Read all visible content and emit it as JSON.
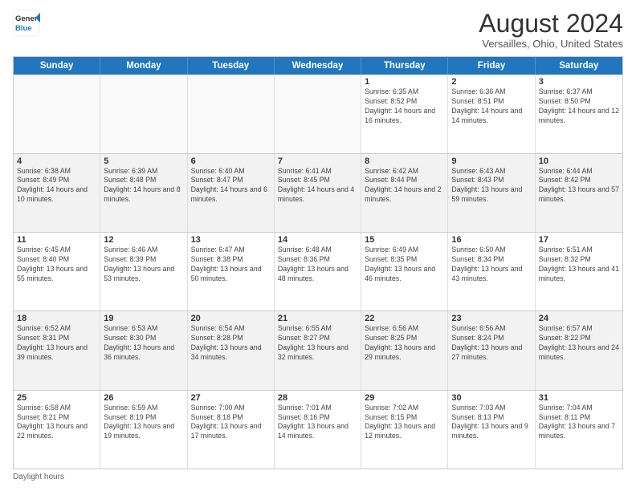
{
  "logo": {
    "general": "General",
    "blue": "Blue"
  },
  "title": "August 2024",
  "subtitle": "Versailles, Ohio, United States",
  "days": [
    "Sunday",
    "Monday",
    "Tuesday",
    "Wednesday",
    "Thursday",
    "Friday",
    "Saturday"
  ],
  "weeks": [
    [
      {
        "day": "",
        "text": ""
      },
      {
        "day": "",
        "text": ""
      },
      {
        "day": "",
        "text": ""
      },
      {
        "day": "",
        "text": ""
      },
      {
        "day": "1",
        "text": "Sunrise: 6:35 AM\nSunset: 8:52 PM\nDaylight: 14 hours and 16 minutes."
      },
      {
        "day": "2",
        "text": "Sunrise: 6:36 AM\nSunset: 8:51 PM\nDaylight: 14 hours and 14 minutes."
      },
      {
        "day": "3",
        "text": "Sunrise: 6:37 AM\nSunset: 8:50 PM\nDaylight: 14 hours and 12 minutes."
      }
    ],
    [
      {
        "day": "4",
        "text": "Sunrise: 6:38 AM\nSunset: 8:49 PM\nDaylight: 14 hours and 10 minutes."
      },
      {
        "day": "5",
        "text": "Sunrise: 6:39 AM\nSunset: 8:48 PM\nDaylight: 14 hours and 8 minutes."
      },
      {
        "day": "6",
        "text": "Sunrise: 6:40 AM\nSunset: 8:47 PM\nDaylight: 14 hours and 6 minutes."
      },
      {
        "day": "7",
        "text": "Sunrise: 6:41 AM\nSunset: 8:45 PM\nDaylight: 14 hours and 4 minutes."
      },
      {
        "day": "8",
        "text": "Sunrise: 6:42 AM\nSunset: 8:44 PM\nDaylight: 14 hours and 2 minutes."
      },
      {
        "day": "9",
        "text": "Sunrise: 6:43 AM\nSunset: 8:43 PM\nDaylight: 13 hours and 59 minutes."
      },
      {
        "day": "10",
        "text": "Sunrise: 6:44 AM\nSunset: 8:42 PM\nDaylight: 13 hours and 57 minutes."
      }
    ],
    [
      {
        "day": "11",
        "text": "Sunrise: 6:45 AM\nSunset: 8:40 PM\nDaylight: 13 hours and 55 minutes."
      },
      {
        "day": "12",
        "text": "Sunrise: 6:46 AM\nSunset: 8:39 PM\nDaylight: 13 hours and 53 minutes."
      },
      {
        "day": "13",
        "text": "Sunrise: 6:47 AM\nSunset: 8:38 PM\nDaylight: 13 hours and 50 minutes."
      },
      {
        "day": "14",
        "text": "Sunrise: 6:48 AM\nSunset: 8:36 PM\nDaylight: 13 hours and 48 minutes."
      },
      {
        "day": "15",
        "text": "Sunrise: 6:49 AM\nSunset: 8:35 PM\nDaylight: 13 hours and 46 minutes."
      },
      {
        "day": "16",
        "text": "Sunrise: 6:50 AM\nSunset: 8:34 PM\nDaylight: 13 hours and 43 minutes."
      },
      {
        "day": "17",
        "text": "Sunrise: 6:51 AM\nSunset: 8:32 PM\nDaylight: 13 hours and 41 minutes."
      }
    ],
    [
      {
        "day": "18",
        "text": "Sunrise: 6:52 AM\nSunset: 8:31 PM\nDaylight: 13 hours and 39 minutes."
      },
      {
        "day": "19",
        "text": "Sunrise: 6:53 AM\nSunset: 8:30 PM\nDaylight: 13 hours and 36 minutes."
      },
      {
        "day": "20",
        "text": "Sunrise: 6:54 AM\nSunset: 8:28 PM\nDaylight: 13 hours and 34 minutes."
      },
      {
        "day": "21",
        "text": "Sunrise: 6:55 AM\nSunset: 8:27 PM\nDaylight: 13 hours and 32 minutes."
      },
      {
        "day": "22",
        "text": "Sunrise: 6:56 AM\nSunset: 8:25 PM\nDaylight: 13 hours and 29 minutes."
      },
      {
        "day": "23",
        "text": "Sunrise: 6:56 AM\nSunset: 8:24 PM\nDaylight: 13 hours and 27 minutes."
      },
      {
        "day": "24",
        "text": "Sunrise: 6:57 AM\nSunset: 8:22 PM\nDaylight: 13 hours and 24 minutes."
      }
    ],
    [
      {
        "day": "25",
        "text": "Sunrise: 6:58 AM\nSunset: 8:21 PM\nDaylight: 13 hours and 22 minutes."
      },
      {
        "day": "26",
        "text": "Sunrise: 6:59 AM\nSunset: 8:19 PM\nDaylight: 13 hours and 19 minutes."
      },
      {
        "day": "27",
        "text": "Sunrise: 7:00 AM\nSunset: 8:18 PM\nDaylight: 13 hours and 17 minutes."
      },
      {
        "day": "28",
        "text": "Sunrise: 7:01 AM\nSunset: 8:16 PM\nDaylight: 13 hours and 14 minutes."
      },
      {
        "day": "29",
        "text": "Sunrise: 7:02 AM\nSunset: 8:15 PM\nDaylight: 13 hours and 12 minutes."
      },
      {
        "day": "30",
        "text": "Sunrise: 7:03 AM\nSunset: 8:13 PM\nDaylight: 13 hours and 9 minutes."
      },
      {
        "day": "31",
        "text": "Sunrise: 7:04 AM\nSunset: 8:11 PM\nDaylight: 13 hours and 7 minutes."
      }
    ]
  ],
  "footer": "Daylight hours"
}
